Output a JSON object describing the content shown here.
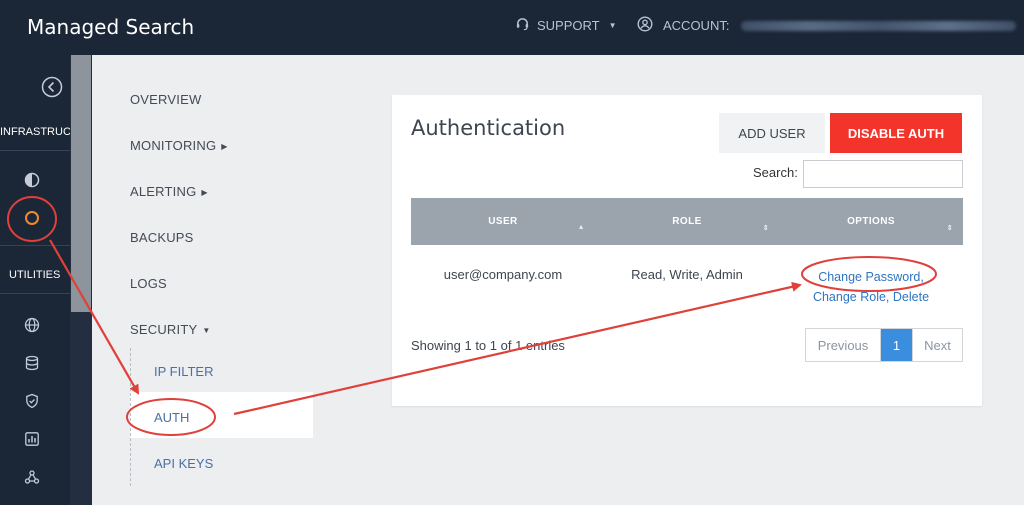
{
  "app": {
    "title": "Managed Search"
  },
  "topbar": {
    "support_label": "SUPPORT",
    "account_label": "ACCOUNT:"
  },
  "rail": {
    "section_infrastructure": "INFRASTRUCTURE",
    "section_utilities": "UTILITIES",
    "icons": [
      "collapse-icon",
      "half-circle-icon",
      "circle-icon",
      "globe-icon",
      "database-icon",
      "shield-icon",
      "bar-chart-icon",
      "nodes-icon"
    ]
  },
  "subnav": {
    "overview": "OVERVIEW",
    "monitoring": "MONITORING",
    "alerting": "ALERTING",
    "backups": "BACKUPS",
    "logs": "LOGS",
    "security": "SECURITY",
    "ip_filter": "IP FILTER",
    "auth": "AUTH",
    "api_keys": "API KEYS"
  },
  "card": {
    "title": "Authentication",
    "add_user_label": "ADD USER",
    "disable_auth_label": "DISABLE AUTH",
    "search_label": "Search:",
    "search_value": "",
    "columns": [
      "USER",
      "ROLE",
      "OPTIONS"
    ],
    "rows": [
      {
        "user": "user@company.com",
        "role": "Read, Write, Admin",
        "options": {
          "change_password": "Change Password,",
          "change_role": "Change Role,",
          "delete": "Delete"
        }
      }
    ],
    "showing_text": "Showing 1 to 1 of 1 entries",
    "pagination": {
      "previous": "Previous",
      "current": "1",
      "next": "Next"
    }
  },
  "colors": {
    "topbar": "#1b2637",
    "accent_red": "#f2342b",
    "link_blue": "#2f75c1",
    "page_active": "#3b8ddd",
    "annotation_red": "#e0403a"
  }
}
